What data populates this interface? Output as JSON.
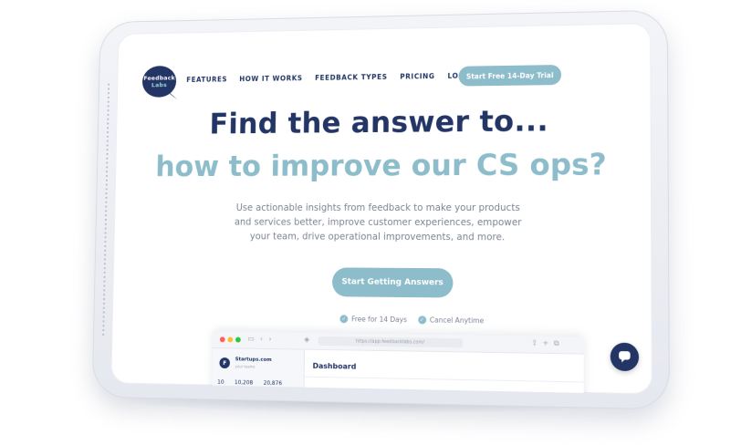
{
  "colors": {
    "brand_navy": "#233565",
    "brand_light_blue": "#8dbccb",
    "body_text": "#7d8494",
    "device_shell": "#e6e8ef"
  },
  "logo": {
    "line1": "Feedback",
    "line2": "Labs"
  },
  "nav": {
    "items": [
      {
        "label": "FEATURES"
      },
      {
        "label": "HOW IT WORKS"
      },
      {
        "label": "FEEDBACK TYPES"
      },
      {
        "label": "PRICING"
      },
      {
        "label": "LOG IN"
      }
    ],
    "cta_label": "Start Free 14-Day Trial"
  },
  "hero": {
    "title": "Find the answer to...",
    "subtitle": "how to improve our CS ops?",
    "description": "Use actionable insights from feedback to make your products and services better, improve customer experiences, empower your team, drive operational improvements, and more.",
    "cta_label": "Start Getting Answers",
    "perks": [
      {
        "label": "Free for 14 Days",
        "icon": "check-icon"
      },
      {
        "label": "Cancel Anytime",
        "icon": "check-icon"
      }
    ]
  },
  "preview": {
    "url": "https://app.feedbacklabs.com/",
    "org_initial": "F",
    "org_name": "Startups.com",
    "org_sub": "your teams",
    "stats": [
      "10",
      "10,208",
      "20,876"
    ],
    "dashboard_title": "Dashboard"
  },
  "chat": {
    "icon": "chat-bubble-icon"
  }
}
